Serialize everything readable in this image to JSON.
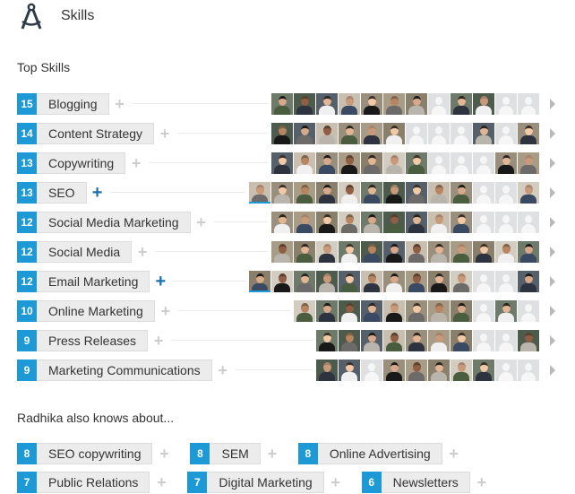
{
  "section": {
    "title": "Skills",
    "icon": "compass-icon"
  },
  "top_skills": {
    "heading": "Top Skills",
    "colors": {
      "count_badge": "#1d99d5",
      "pill": "#ececec",
      "plus_added": "#1d6fa5",
      "plus_default": "#cdcdcd"
    },
    "items": [
      {
        "count": "15",
        "name": "Blogging",
        "endorsed": false,
        "thumbs": [
          1,
          1,
          1,
          1,
          1,
          1,
          1,
          0,
          1,
          1,
          0,
          0
        ]
      },
      {
        "count": "14",
        "name": "Content Strategy",
        "endorsed": false,
        "thumbs": [
          1,
          1,
          1,
          1,
          1,
          1,
          0,
          0,
          0,
          1,
          0,
          1
        ]
      },
      {
        "count": "13",
        "name": "Copywriting",
        "endorsed": false,
        "thumbs": [
          1,
          1,
          1,
          1,
          1,
          1,
          1,
          0,
          0,
          0,
          1,
          1
        ]
      },
      {
        "count": "13",
        "name": "SEO",
        "endorsed": true,
        "thumbs": [
          1,
          1,
          1,
          1,
          1,
          1,
          1,
          1,
          1,
          1,
          0,
          0,
          1
        ]
      },
      {
        "count": "12",
        "name": "Social Media Marketing",
        "endorsed": false,
        "thumbs": [
          1,
          1,
          1,
          1,
          1,
          1,
          1,
          1,
          1,
          0,
          0,
          0
        ]
      },
      {
        "count": "12",
        "name": "Social Media",
        "endorsed": false,
        "thumbs": [
          1,
          1,
          1,
          1,
          1,
          1,
          1,
          1,
          1,
          1,
          1,
          1
        ]
      },
      {
        "count": "12",
        "name": "Email Marketing",
        "endorsed": true,
        "thumbs": [
          1,
          1,
          1,
          1,
          1,
          1,
          1,
          1,
          1,
          1,
          0,
          0,
          1
        ]
      },
      {
        "count": "10",
        "name": "Online Marketing",
        "endorsed": false,
        "thumbs": [
          1,
          1,
          1,
          1,
          1,
          1,
          1,
          1,
          0,
          1,
          0
        ]
      },
      {
        "count": "9",
        "name": "Press Releases",
        "endorsed": false,
        "thumbs": [
          1,
          1,
          1,
          1,
          1,
          1,
          1,
          0,
          0,
          1
        ]
      },
      {
        "count": "9",
        "name": "Marketing Communications",
        "endorsed": false,
        "thumbs": [
          1,
          1,
          0,
          1,
          1,
          1,
          1,
          1,
          0,
          0
        ]
      }
    ]
  },
  "also_knows": {
    "heading": "Radhika also knows about...",
    "rows": [
      [
        {
          "count": "8",
          "name": "SEO copywriting"
        },
        {
          "count": "8",
          "name": "SEM"
        },
        {
          "count": "8",
          "name": "Online Advertising"
        }
      ],
      [
        {
          "count": "7",
          "name": "Public Relations"
        },
        {
          "count": "7",
          "name": "Digital Marketing"
        },
        {
          "count": "6",
          "name": "Newsletters"
        }
      ]
    ]
  }
}
